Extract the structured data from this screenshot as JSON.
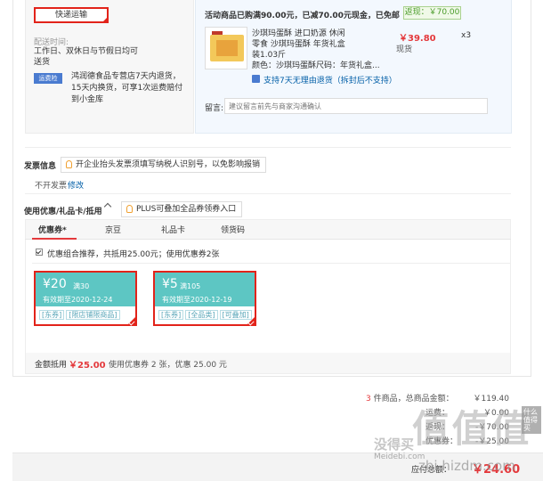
{
  "shipping": {
    "method_button": "快递运输",
    "delivery_time_label": "配送时间:",
    "delivery_time_value": "工作日、双休日与节假日均可送货",
    "return_badge": "运费险",
    "return_text": "鸿润德食品专营店7天内退货，15天内换货，可享1次运费赔付到小金库"
  },
  "promo": {
    "text": "活动商品已购满90.00元，已减70.00元现金，已免邮",
    "badge": "返现：￥70.00"
  },
  "product": {
    "name": "沙琪玛蛋酥 进口奶源 休闲零食 沙琪玛蛋酥 年货礼盒装1.03斤",
    "price": "￥39.80",
    "stock": "现货",
    "qty": "x3",
    "attrs": "颜色：沙琪玛蛋酥尺码：年货礼盒...",
    "service": "支持7天无理由退货（拆封后不支持）"
  },
  "message": {
    "label": "留言:",
    "placeholder": "建议留言前先与商家沟通确认"
  },
  "invoice": {
    "title": "发票信息",
    "tip": "开企业抬头发票须填写纳税人识别号，以免影响报销",
    "value": "不开发票",
    "edit": "修改"
  },
  "discount": {
    "title": "使用优惠/礼品卡/抵用",
    "plus_tip": "PLUS可叠加全品券领券入口",
    "tabs": [
      "优惠券*",
      "京豆",
      "礼品卡",
      "领货码"
    ],
    "recommend": "优惠组合推荐，共抵用25.00元；使用优惠券2张",
    "coupons": [
      {
        "amount": "¥20",
        "cond": "满30",
        "expire": "有效期至2020-12-24",
        "tags": [
          "[东券]",
          "[限店铺限商品]"
        ]
      },
      {
        "amount": "¥5",
        "cond": "满105",
        "expire": "有效期至2020-12-19",
        "tags": [
          "[东券]",
          "[全品类]",
          "[可叠加]"
        ]
      }
    ],
    "footer_label": "金额抵用",
    "footer_amount": "￥25.00",
    "footer_detail": "使用优惠券 2 张，优惠 25.00 元"
  },
  "summary": {
    "count": "3",
    "count_text": "件商品，总商品金额：",
    "total": "￥119.40",
    "row2_label": "运费：",
    "row2_value": "￥0.00",
    "row3_label": "返现：",
    "row3_value": "-￥70.00",
    "row4_label": "优惠券：",
    "row4_value": "-￥25.00",
    "pay_label": "应付总额：",
    "pay_value": "￥24.60"
  },
  "watermark": {
    "main": "值 值 值",
    "site": "什么值得买",
    "sub": "没得买",
    "url": "Meidebi.com",
    "smzdm": "zhi.hizdm.com"
  }
}
